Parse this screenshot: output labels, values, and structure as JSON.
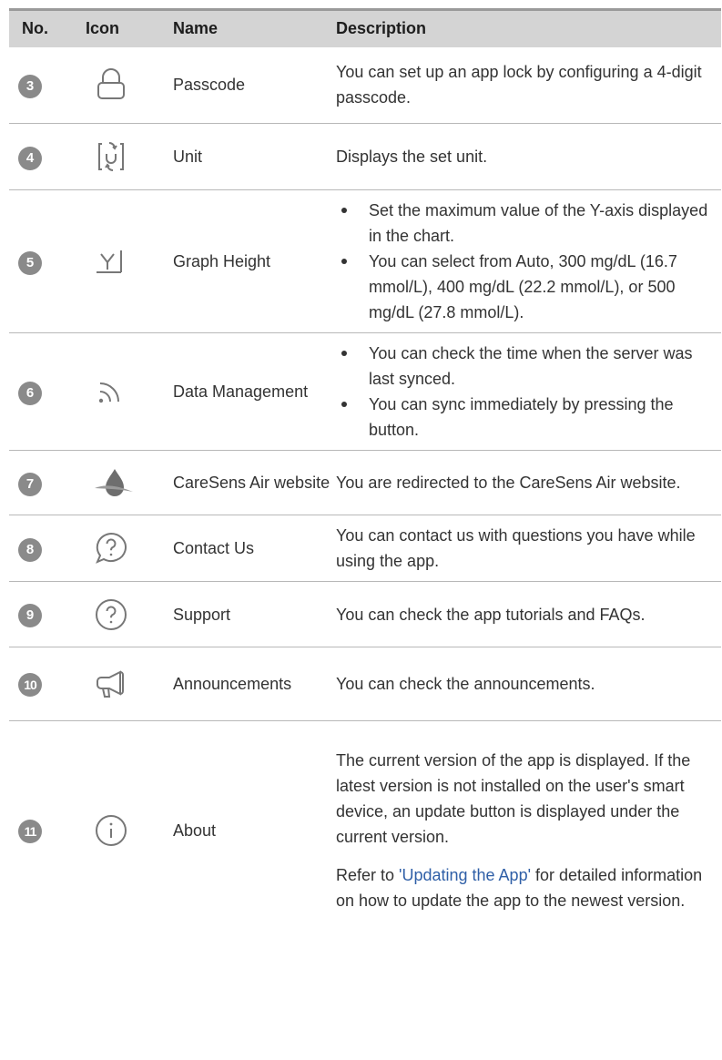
{
  "header": {
    "no": "No.",
    "icon": "Icon",
    "name": "Name",
    "description": "Description"
  },
  "rows": [
    {
      "no": "3",
      "icon": "lock-icon",
      "name": "Passcode",
      "description": "You can set up an app lock by configuring a 4-digit passcode."
    },
    {
      "no": "4",
      "icon": "unit-switch-icon",
      "name": "Unit",
      "description": "Displays the set unit."
    },
    {
      "no": "5",
      "icon": "graph-height-icon",
      "name": "Graph Height",
      "bullets": [
        "Set the maximum value of the Y-axis displayed in the chart.",
        "You can select from Auto, 300 mg/dL (16.7 mmol/L), 400 mg/dL (22.2 mmol/L), or 500 mg/dL (27.8 mmol/L)."
      ]
    },
    {
      "no": "6",
      "icon": "sync-icon",
      "name": "Data Management",
      "bullets": [
        "You can check the time when the server was last synced.",
        "You can sync immediately by pressing the button."
      ]
    },
    {
      "no": "7",
      "icon": "caresens-drop-icon",
      "name": "CareSens Air website",
      "description": "You are redirected to the CareSens Air website."
    },
    {
      "no": "8",
      "icon": "chat-question-icon",
      "name": "Contact Us",
      "description": "You can contact us with questions you have while using the app."
    },
    {
      "no": "9",
      "icon": "help-circle-icon",
      "name": "Support",
      "description": "You can check the app tutorials and FAQs."
    },
    {
      "no": "10",
      "icon": "megaphone-icon",
      "name": "Announcements",
      "description": "You can check the announcements."
    },
    {
      "no": "11",
      "icon": "info-circle-icon",
      "name": "About",
      "description": "The current version of the app is displayed. If the latest version is not installed on the user's smart device, an update button is displayed under the current version.",
      "note_prefix": "Refer to ",
      "note_link": "'Updating the App'",
      "note_suffix": " for detailed information on how to update the app to the newest version."
    }
  ],
  "colors": {
    "header_bg": "#d4d4d4",
    "badge": "#8a8a8a",
    "link": "#2f5fa7",
    "icon_stroke": "#777777"
  }
}
